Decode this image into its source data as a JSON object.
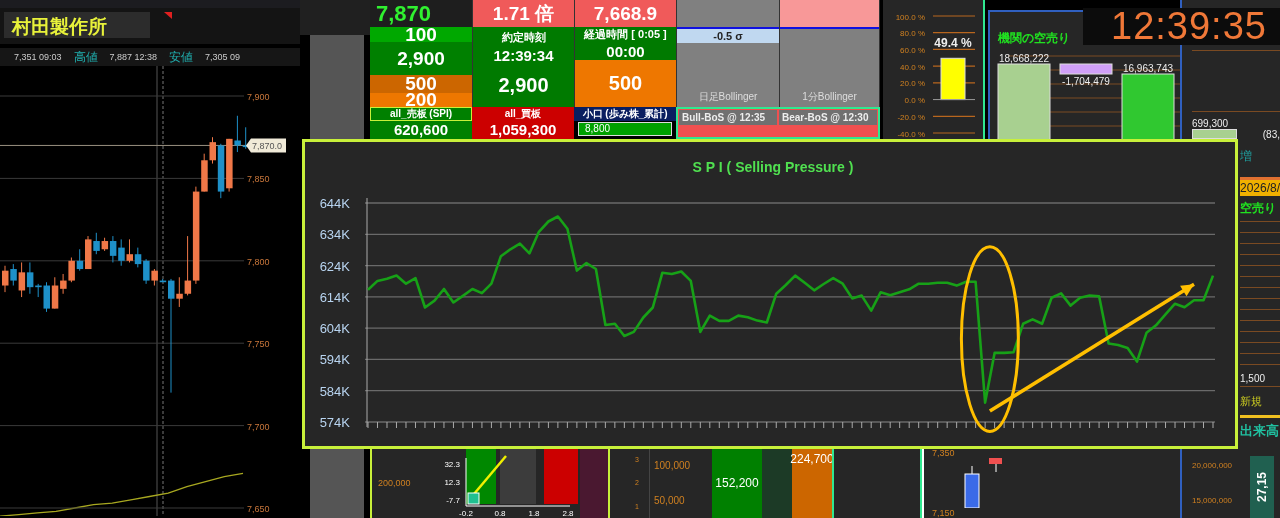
{
  "title_bar": {
    "stock_name": "村田製作所"
  },
  "price_info": [
    {
      "text": "7,351 09:03",
      "kind": "value"
    },
    {
      "text": "高値",
      "kind": "label"
    },
    {
      "text": "7,887 12:38",
      "kind": "value"
    },
    {
      "text": "安値",
      "kind": "label"
    },
    {
      "text": "7,305 09",
      "kind": "value"
    }
  ],
  "candle_chart": {
    "chart_data": {
      "type": "candlestick",
      "categories": [
        null,
        null,
        null,
        null,
        null,
        null,
        null,
        null,
        null,
        null,
        null,
        null,
        null,
        null,
        null,
        null,
        null,
        null,
        null,
        null,
        null,
        null,
        null,
        null,
        null,
        null,
        null,
        null,
        null,
        null
      ],
      "ylim": [
        7650,
        7900
      ],
      "yticks": [
        {
          "value": 7900,
          "label": "7,900"
        },
        {
          "value": 7850,
          "label": "7,850"
        },
        {
          "value": 7800,
          "label": "7,800"
        },
        {
          "value": 7750,
          "label": "7,750"
        },
        {
          "value": 7700,
          "label": "7,700"
        },
        {
          "value": 7650,
          "label": "7,650"
        }
      ],
      "grid": true,
      "ohlc": [
        [
          7785,
          7797,
          7781,
          7794
        ],
        [
          7795,
          7798,
          7785,
          7788
        ],
        [
          7782,
          7799,
          7778,
          7793
        ],
        [
          7793,
          7799,
          7780,
          7784
        ],
        [
          7785,
          7786,
          7778,
          7784
        ],
        [
          7785,
          7787,
          7769,
          7771
        ],
        [
          7771,
          7790,
          7771,
          7785
        ],
        [
          7783,
          7792,
          7780,
          7788
        ],
        [
          7788,
          7802,
          7787,
          7800
        ],
        [
          7800,
          7807,
          7794,
          7795
        ],
        [
          7795,
          7815,
          7795,
          7813
        ],
        [
          7812,
          7817,
          7804,
          7806
        ],
        [
          7807,
          7814,
          7806,
          7812
        ],
        [
          7812,
          7815,
          7799,
          7803
        ],
        [
          7808,
          7813,
          7797,
          7800
        ],
        [
          7800,
          7813,
          7799,
          7804
        ],
        [
          7804,
          7808,
          7796,
          7798
        ],
        [
          7800,
          7801,
          7786,
          7788
        ],
        [
          7788,
          7795,
          7785,
          7794
        ],
        [
          7788,
          7789,
          7787,
          7787
        ],
        [
          7788,
          7789,
          7720,
          7777
        ],
        [
          7777,
          7790,
          7772,
          7780
        ],
        [
          7780,
          7815,
          7779,
          7788
        ],
        [
          7788,
          7845,
          7786,
          7842
        ],
        [
          7842,
          7865,
          7842,
          7861
        ],
        [
          7861,
          7875,
          7859,
          7872
        ],
        [
          7870,
          7871,
          7838,
          7842
        ],
        [
          7844,
          7874,
          7842,
          7874
        ],
        [
          7873,
          7888,
          7866,
          7870
        ],
        [
          7870,
          7881,
          7868,
          7869
        ]
      ]
    },
    "last_price": "7,870.0"
  },
  "board": {
    "top_values": [
      "7,870",
      "1.71 倍",
      "7,668.9"
    ],
    "volume_stack": [
      "100",
      "2,900",
      "500",
      "200"
    ],
    "trade_time": {
      "label": "約定時刻",
      "time": "12:39:34",
      "volume": "2,900"
    },
    "elapsed": {
      "label": "経過時間 [ 0:05 ]",
      "time": "00:00",
      "volume": "500"
    },
    "sigma": "-0.5 σ",
    "bollinger": [
      "日足Bollinger",
      "1分Bollinger"
    ],
    "order_books": [
      {
        "label": "all_売板 (SPI)",
        "value": "620,600",
        "kind": "sell"
      },
      {
        "label": "all_買板",
        "value": "1,059,300",
        "kind": "buy"
      },
      {
        "label": "小口 (歩み株_累計)",
        "value": "8,800",
        "kind": "small"
      }
    ],
    "bos": [
      "Bull-BoS @ 12:35",
      "Bear-BoS @ 12:30"
    ]
  },
  "ratio_gauge": {
    "chart_data": {
      "type": "bar",
      "grid": true,
      "values": [
        49.4
      ],
      "ylim": [
        -40,
        100
      ],
      "yticks": [
        {
          "value": 100,
          "label": "100.0 %"
        },
        {
          "value": 80,
          "label": "80.0 %"
        },
        {
          "value": 60,
          "label": "60.0 %"
        },
        {
          "value": 40,
          "label": "40.0 %"
        },
        {
          "value": 20,
          "label": "20.0 %"
        },
        {
          "value": 0,
          "label": "0.0 %"
        },
        {
          "value": -20,
          "label": "-20.0 %"
        },
        {
          "value": -40,
          "label": "-40.0 %"
        }
      ],
      "value_labels": [
        "49.4 %"
      ]
    }
  },
  "institutional_short": {
    "title": "機関の空売り",
    "bars": [
      {
        "value": "18,668,222",
        "kind": "total"
      },
      {
        "value": "-1,704,479",
        "kind": "change"
      },
      {
        "value": "16,963,743",
        "kind": "total"
      }
    ]
  },
  "clock": "12:39:35",
  "right_panel": {
    "bar_value": "699,300",
    "side_value": "(83,",
    "change_label": "増",
    "date": "2026/8/",
    "short_title": "空売り",
    "short_value": "1,500",
    "new_label": "新規",
    "volume_title": "出来高"
  },
  "spi_chart": {
    "chart_data": {
      "type": "line",
      "title": "S P I  ( Selling Pressure )",
      "ylim": [
        574000,
        644000
      ],
      "grid": true,
      "yticks": [
        {
          "value": 574000,
          "label": "574K"
        },
        {
          "value": 584000,
          "label": "584K"
        },
        {
          "value": 594000,
          "label": "594K"
        },
        {
          "value": 604000,
          "label": "604K"
        },
        {
          "value": 614000,
          "label": "614K"
        },
        {
          "value": 624000,
          "label": "624K"
        },
        {
          "value": 634000,
          "label": "634K"
        },
        {
          "value": 644000,
          "label": "644K"
        }
      ],
      "series": [
        {
          "color": "#17a117",
          "values": [
            616300,
            619100,
            619800,
            620800,
            618200,
            620000,
            610600,
            612800,
            616500,
            612200,
            614300,
            616500,
            615200,
            618200,
            627000,
            629200,
            631000,
            627900,
            634800,
            638100,
            639700,
            635800,
            622400,
            624800,
            622900,
            605000,
            605400,
            601500,
            602800,
            607400,
            610600,
            621700,
            621300,
            622100,
            619100,
            602800,
            608000,
            606300,
            606300,
            608000,
            607500,
            606400,
            605800,
            615000,
            617800,
            620800,
            618500,
            616100,
            618100,
            620000,
            618200,
            613500,
            614400,
            609600,
            615500,
            614500,
            615500,
            616400,
            618200,
            618200,
            618500,
            618500,
            617600,
            618800,
            618800,
            580200,
            596100,
            596100,
            596300,
            605400,
            606800,
            605400,
            613700,
            615100,
            611200,
            613700,
            614400,
            614200,
            599100,
            598600,
            597700,
            593300,
            602500,
            604900,
            608400,
            611800,
            610700,
            612900,
            612900,
            620800
          ]
        }
      ]
    },
    "markers": [
      {
        "kind": "ellipse"
      },
      {
        "kind": "arrow"
      }
    ]
  },
  "bottom_strip": {
    "axis_label": "200,000",
    "scatter": {
      "y_labels": [
        "32.3",
        "12.3",
        "-7.7"
      ],
      "x_labels": [
        "-0.2",
        "0.8",
        "1.8",
        "2.8"
      ]
    },
    "small_ticks": [
      "3",
      "2",
      "1"
    ],
    "volume_ticks": [
      "100,000",
      "50,000"
    ],
    "volume_values": [
      "152,200",
      "224,700"
    ],
    "price_ticks": [
      "7,350",
      "7,150"
    ],
    "big_ticks": [
      "20,000,000",
      "15,000,000"
    ],
    "edge_value": "27,15"
  }
}
